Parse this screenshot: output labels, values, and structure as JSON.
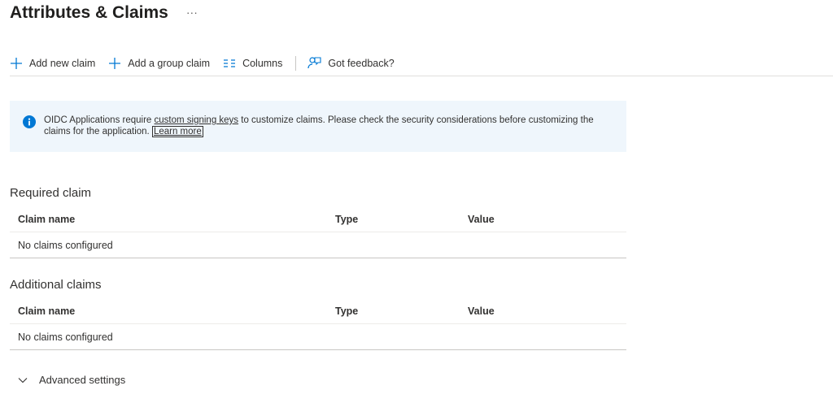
{
  "page": {
    "title": "Attributes & Claims",
    "more_label": "···"
  },
  "toolbar": {
    "add_claim_label": "Add new claim",
    "add_group_claim_label": "Add a group claim",
    "columns_label": "Columns",
    "feedback_label": "Got feedback?"
  },
  "info": {
    "text_before": "OIDC Applications require ",
    "link_text": "custom signing keys",
    "text_after": " to customize claims. Please check the security considerations before customizing the claims for the application. ",
    "learn_more": "Learn more"
  },
  "required": {
    "title": "Required claim",
    "columns": [
      "Claim name",
      "Type",
      "Value"
    ],
    "empty_text": "No claims configured"
  },
  "additional": {
    "title": "Additional claims",
    "columns": [
      "Claim name",
      "Type",
      "Value"
    ],
    "empty_text": "No claims configured"
  },
  "advanced": {
    "label": "Advanced settings"
  },
  "colors": {
    "accent": "#0078d4",
    "info_bg": "#eff6fc"
  }
}
